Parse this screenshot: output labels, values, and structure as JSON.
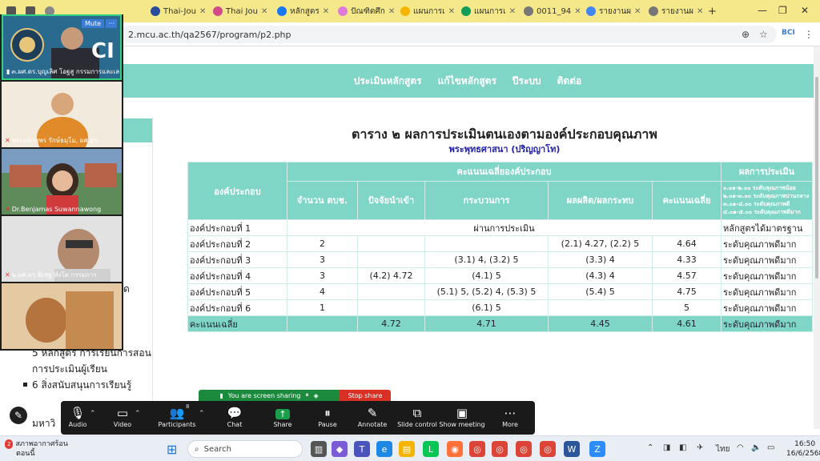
{
  "browser": {
    "tabs": [
      {
        "label": "",
        "icon": "window-icon",
        "color": "#555555"
      },
      {
        "label": "",
        "icon": "tab-list-icon",
        "color": "#555555"
      },
      {
        "label": "",
        "icon": "cliplink-icon",
        "color": "#888888"
      },
      {
        "label": "Thai-Jou",
        "icon": "thaijo-icon",
        "color": "#2a4d9b"
      },
      {
        "label": "Thai Jou",
        "icon": "thaijo-icon",
        "color": "#d14a8a"
      },
      {
        "label": "หลักสูตร",
        "icon": "facebook-icon",
        "color": "#1877f2"
      },
      {
        "label": "ปัณฑิตศึก",
        "icon": "colorful-icon",
        "color": "#e07ad8"
      },
      {
        "label": "แผนการเ",
        "icon": "drive-icon",
        "color": "#f4b400"
      },
      {
        "label": "แผนการเ",
        "icon": "drive-icon",
        "color": "#0f9d58"
      },
      {
        "label": "0011_94",
        "icon": "globe-icon",
        "color": "#777777"
      },
      {
        "label": "รายงานผ",
        "icon": "drive-icon",
        "color": "#4285f4"
      },
      {
        "label": "รายงานผ",
        "icon": "globe-icon",
        "color": "#777777"
      }
    ],
    "new_tab": "+",
    "url": "2.mcu.ac.th/qa2567/program/p2.php"
  },
  "page": {
    "nav": [
      "ประเมินหลักสูตร",
      "แก้ไขหลักสูตร",
      "ปีระบบ",
      "ติดต่อ"
    ],
    "table_title": "ตาราง ๒ ผลการประเมินตนเองตามองค์ประกอบคุณภาพ",
    "table_subtitle": "พระพุทธศาสนา (ปริญญาโท)",
    "headers": {
      "component": "องค์ประกอบ",
      "avg_group": "คะแนนเฉลี่ยองค์ประกอบ",
      "count": "จำนวน ตบช.",
      "input": "ปัจจัยนำเข้า",
      "process": "กระบวนการ",
      "output": "ผลผลิต/ผลกระทบ",
      "avg": "คะแนนเฉลี่ย",
      "result": "ผลการประเมิน"
    },
    "legend": [
      "๐.๐๑-๒.๐๐ ระดับคุณภาพน้อย",
      "๒.๐๑-๓.๐๐ ระดับคุณภาพปานกลาง",
      "๓.๐๑-๔.๐๐ ระดับคุณภาพดี",
      "๔.๐๑-๕.๐๐ ระดับคุณภาพดีมาก"
    ],
    "row1": {
      "name": "องค์ประกอบที่ 1",
      "merged": "ผ่านการประเมิน",
      "result": "หลักสูตรได้มาตรฐาน"
    },
    "rows": [
      {
        "name": "องค์ประกอบที่ 2",
        "count": "2",
        "input": "",
        "process": "",
        "output": "(2.1) 4.27, (2.2) 5",
        "avg": "4.64",
        "result": "ระดับคุณภาพดีมาก"
      },
      {
        "name": "องค์ประกอบที่ 3",
        "count": "3",
        "input": "",
        "process": "(3.1) 4, (3.2) 5",
        "output": "(3.3) 4",
        "avg": "4.33",
        "result": "ระดับคุณภาพดีมาก"
      },
      {
        "name": "องค์ประกอบที่ 4",
        "count": "3",
        "input": "(4.2) 4.72",
        "process": "(4.1) 5",
        "output": "(4.3) 4",
        "avg": "4.57",
        "result": "ระดับคุณภาพดีมาก"
      },
      {
        "name": "องค์ประกอบที่ 5",
        "count": "4",
        "input": "",
        "process": "(5.1) 5, (5.2) 4, (5.3) 5",
        "output": "(5.4) 5",
        "avg": "4.75",
        "result": "ระดับคุณภาพดีมาก"
      },
      {
        "name": "องค์ประกอบที่ 6",
        "count": "1",
        "input": "",
        "process": "(6.1) 5",
        "output": "",
        "avg": "5",
        "result": "ระดับคุณภาพดีมาก"
      }
    ],
    "avg_row": {
      "name": "คะแนนเฉลี่ย",
      "count": "",
      "input": "4.72",
      "process": "4.71",
      "output": "4.45",
      "avg": "4.61",
      "result": "ระดับคุณภาพดีมาก"
    },
    "sidebar": {
      "partial_item": "ด",
      "item5_line1": "5 หลักสูตร การเรียนการสอน",
      "item5_line2": "การประเมินผู้เรียน",
      "item6": "6 สิ่งสนับสนุนการเรียนรู้",
      "bottom": "มหาวิ"
    }
  },
  "zoom": {
    "participants": [
      {
        "name": "๓.ผศ.ดร.บุญเลิศ โอฐสู กรรมการและเล...",
        "active": true,
        "muted": false
      },
      {
        "name": "พระมหาสุพร รักษ์ธมฺโม, ผศ.ดร.",
        "active": false,
        "muted": true
      },
      {
        "name": "Dr.Benjamas Suwannawong",
        "active": false,
        "muted": true
      },
      {
        "name": "๒.ผศ.ดร.พิเชฐ ทั่งโต กรรมการ",
        "active": false,
        "muted": true
      }
    ],
    "mute_label": "Mute",
    "more_label": "···",
    "share_banner": "You are screen sharing",
    "stop_share": "Stop share",
    "controls": {
      "audio": "Audio",
      "video": "Video",
      "participants": "Participants",
      "participants_count": "8",
      "chat": "Chat",
      "share": "Share",
      "pause": "Pause",
      "annotate": "Annotate",
      "slide_control": "Slide control",
      "show_meeting": "Show meeting",
      "more": "More"
    }
  },
  "taskbar": {
    "weather_line1": "สภาพอากาศร้อน",
    "weather_line2": "ตอนนี้",
    "weather_badge": "2",
    "search": "Search",
    "lang": "ไทย",
    "time": "16:50",
    "date": "16/6/2568"
  }
}
